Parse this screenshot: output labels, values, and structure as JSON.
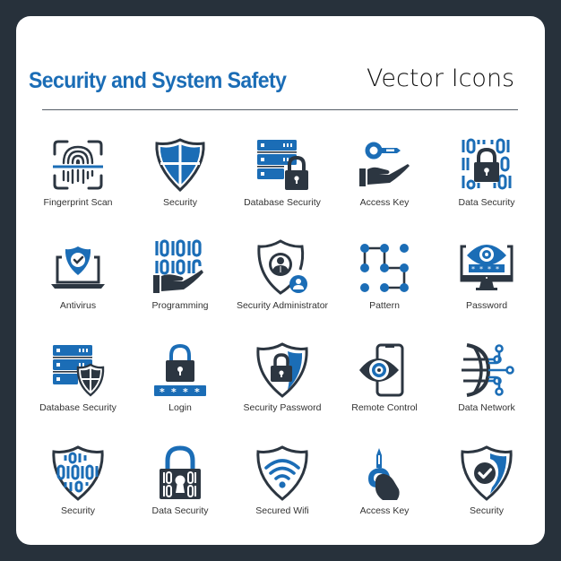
{
  "header": {
    "title": "Security and System Safety",
    "subtitle": "Vector Icons"
  },
  "colors": {
    "background": "#27313b",
    "card": "#ffffff",
    "accent_blue": "#1b6db6",
    "icon_dark": "#2c3641",
    "label_text": "#333333"
  },
  "icons": [
    {
      "label": "Fingerprint Scan",
      "icon": "fingerprint-scan-icon"
    },
    {
      "label": "Security",
      "icon": "shield-cross-icon"
    },
    {
      "label": "Database Security",
      "icon": "database-lock-icon"
    },
    {
      "label": "Access Key",
      "icon": "hand-key-icon"
    },
    {
      "label": "Data Security",
      "icon": "binary-lock-icon"
    },
    {
      "label": "Antivirus",
      "icon": "laptop-shield-icon"
    },
    {
      "label": "Programming",
      "icon": "hand-binary-icon"
    },
    {
      "label": "Security Administrator",
      "icon": "shield-admin-icon"
    },
    {
      "label": "Pattern",
      "icon": "pattern-lock-icon"
    },
    {
      "label": "Password",
      "icon": "monitor-eye-password-icon"
    },
    {
      "label": "Database Security",
      "icon": "database-shield-icon"
    },
    {
      "label": "Login",
      "icon": "lock-password-icon"
    },
    {
      "label": "Security Password",
      "icon": "shield-lock-icon"
    },
    {
      "label": "Remote Control",
      "icon": "phone-eye-icon"
    },
    {
      "label": "Data Network",
      "icon": "globe-circuit-icon"
    },
    {
      "label": "Security",
      "icon": "shield-binary-icon"
    },
    {
      "label": "Data Security",
      "icon": "binary-padlock-icon"
    },
    {
      "label": "Secured Wifi",
      "icon": "shield-wifi-icon"
    },
    {
      "label": "Access Key",
      "icon": "hand-turn-key-icon"
    },
    {
      "label": "Security",
      "icon": "shield-check-icon"
    }
  ]
}
